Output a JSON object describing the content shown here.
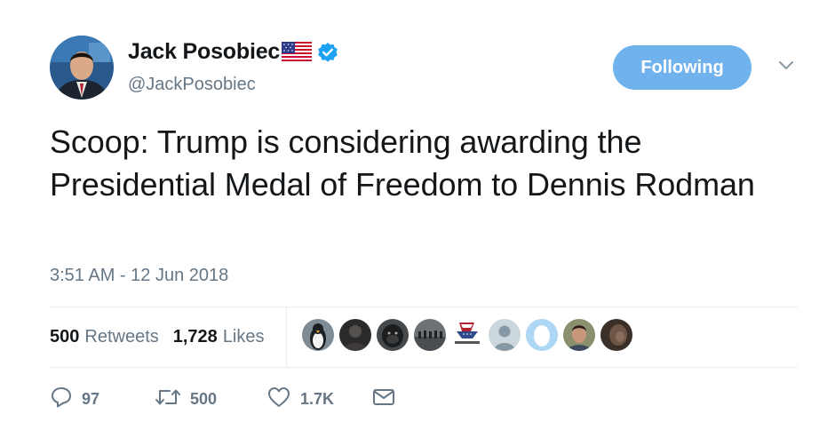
{
  "author": {
    "name": "Jack Posobiec",
    "handle": "@JackPosobiec",
    "flag_icon": "us-flag-icon",
    "verified_icon": "verified-badge-icon"
  },
  "follow_button": {
    "label": "Following",
    "color": "#6fb2ee"
  },
  "menu_icon": "chevron-down-icon",
  "tweet": {
    "text": "Scoop: Trump is considering awarding the Presidential Medal of Freedom to Dennis Rodman",
    "timestamp": "3:51 AM - 12 Jun 2018"
  },
  "stats": {
    "retweets": {
      "count": "500",
      "label": "Retweets"
    },
    "likes": {
      "count": "1,728",
      "label": "Likes"
    }
  },
  "liker_avatars": [
    {
      "kind": "penguin"
    },
    {
      "kind": "dark-photo"
    },
    {
      "kind": "gorilla"
    },
    {
      "kind": "group-photo"
    },
    {
      "kind": "flag-emblem",
      "caption": "MOAZIN AABE"
    },
    {
      "kind": "default-silhouette"
    },
    {
      "kind": "egg"
    },
    {
      "kind": "portrait"
    },
    {
      "kind": "dark-portrait"
    }
  ],
  "actions": {
    "reply": {
      "icon": "reply-icon",
      "count": "97"
    },
    "retweet": {
      "icon": "retweet-icon",
      "count": "500"
    },
    "like": {
      "icon": "heart-icon",
      "count": "1.7K"
    },
    "message": {
      "icon": "envelope-icon"
    }
  },
  "colors": {
    "text": "#14171a",
    "secondary": "#657786",
    "verified": "#1da1f2",
    "divider": "#e6ecf0"
  }
}
